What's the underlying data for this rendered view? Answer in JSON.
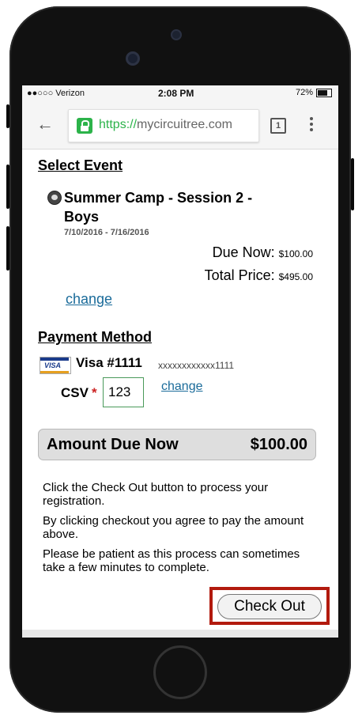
{
  "status_bar": {
    "carrier": "●●○○○ Verizon",
    "time": "2:08 PM",
    "battery": "72%"
  },
  "browser": {
    "url_scheme": "https://",
    "url_host": "mycircuitree.com",
    "tab_count": "1",
    "icons": [
      "back-arrow-icon",
      "lock-icon",
      "tabs-icon",
      "overflow-menu-icon"
    ]
  },
  "event": {
    "heading": "Select Event",
    "name": "Summer Camp - Session 2 - Boys",
    "dates": "7/10/2016 - 7/16/2016",
    "due_now_label": "Due Now:",
    "due_now_value": "$100.00",
    "total_label": "Total Price:",
    "total_value": "$495.00",
    "change_label": "change"
  },
  "payment": {
    "heading": "Payment Method",
    "card_brand_logo": "VISA",
    "card_name": "Visa #1111",
    "card_mask": "xxxxxxxxxxxx1111",
    "csv_label": "CSV",
    "required_marker": "*",
    "csv_value": "123",
    "change_label": "change"
  },
  "amount_due": {
    "label": "Amount Due Now",
    "value": "$100.00"
  },
  "notes": [
    "Click the Check Out button to process your registration.",
    "By clicking checkout you agree to pay the amount above.",
    "Please be patient as this process can sometimes take a few minutes to complete."
  ],
  "checkout": {
    "label": "Check Out",
    "highlight_color": "#b21a0e"
  },
  "colors": {
    "link": "#1a6b9a",
    "secure": "#2cb34a"
  }
}
